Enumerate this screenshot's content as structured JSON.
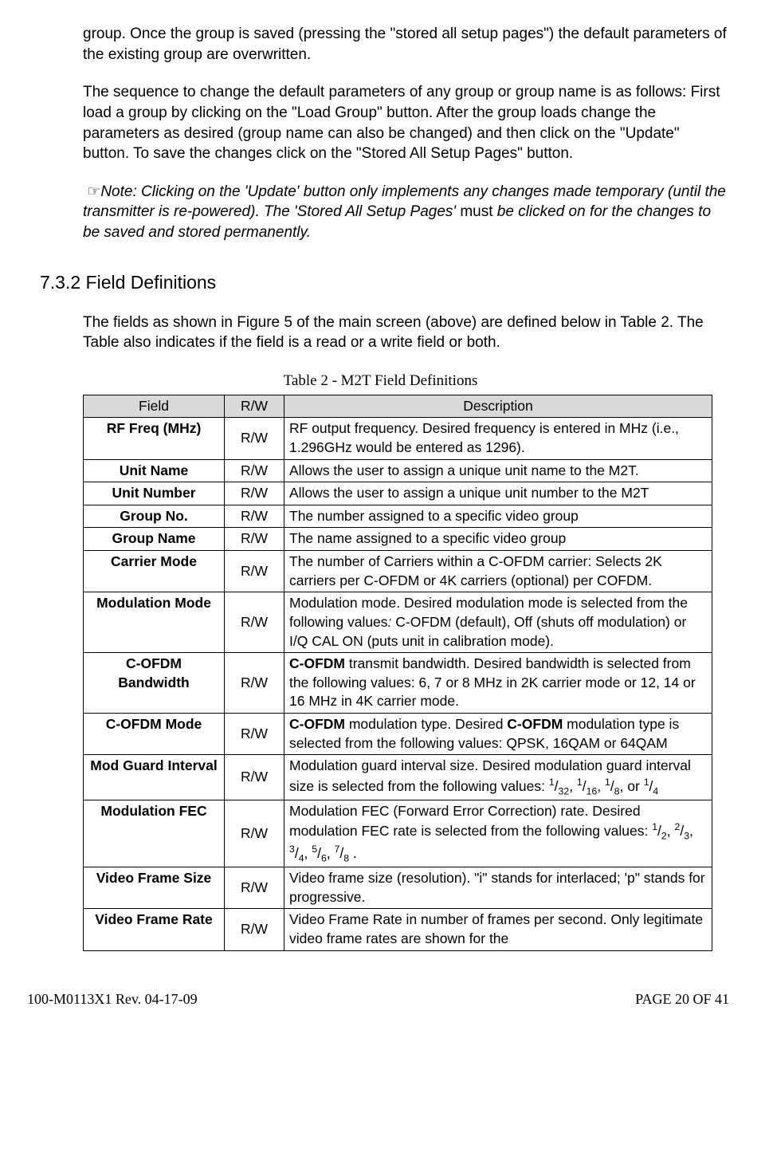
{
  "paragraphs": {
    "p1": "group. Once the group is saved (pressing the \"stored all setup pages\") the default parameters of the existing group are overwritten.",
    "p2": "The sequence to change the default parameters of any group or group name is as follows: First load a group by clicking on the \"Load Group\" button. After the group loads change the parameters as desired (group name can also be changed) and then click on the \"Update\" button.  To save the changes click on the \"Stored All Setup Pages\" button.",
    "note_prefix": "Note: Clicking on the 'Update' button only implements any changes made temporary (until the transmitter is re-powered).  The 'Stored All Setup Pages' ",
    "note_must": "must",
    "note_suffix": " be clicked on for the changes to be saved and stored permanently."
  },
  "section": {
    "number": "7.3.2",
    "title": "Field Definitions"
  },
  "intro": "The fields as shown in Figure 5 of the main screen (above) are defined below in Table 2. The Table also indicates if the field is a read or a write field or both.",
  "table_caption": "Table 2 - M2T Field Definitions",
  "headers": {
    "field": "Field",
    "rw": "R/W",
    "desc": "Description"
  },
  "rows": [
    {
      "field": "RF Freq (MHz)",
      "rw": "R/W",
      "desc": "RF output frequency.  Desired frequency is entered in MHz (i.e., 1.296GHz would be entered as 1296)."
    },
    {
      "field": "Unit Name",
      "rw": "R/W",
      "desc": "Allows the user to assign a unique unit name to the M2T."
    },
    {
      "field": "Unit Number",
      "rw": "R/W",
      "desc": "Allows the user to assign a unique unit number to the M2T"
    },
    {
      "field": "Group No.",
      "rw": "R/W",
      "desc": "The number assigned to a specific video group"
    },
    {
      "field": "Group Name",
      "rw": "R/W",
      "desc": "The name assigned to a specific video group"
    },
    {
      "field": "Carrier Mode",
      "rw": "R/W",
      "desc": "The number of Carriers within a C-OFDM carrier: Selects 2K carriers per C-OFDM or 4K carriers (optional) per COFDM."
    },
    {
      "field": "Modulation Mode",
      "rw": "R/W",
      "desc_pre": "Modulation mode.  Desired modulation mode is selected from the following values",
      "desc_italic": ": ",
      "desc_post": "C-OFDM (default), Off (shuts off modulation) or I/Q CAL ON (puts unit in calibration mode)."
    },
    {
      "field": "C-OFDM Bandwidth",
      "rw": "R/W",
      "desc_bold": "C-OFDM",
      "desc_post": " transmit bandwidth.  Desired bandwidth is selected from the following values:  6, 7 or 8 MHz in 2K carrier mode or 12, 14 or 16 MHz in 4K carrier mode."
    },
    {
      "field": "C-OFDM Mode",
      "rw": "R/W",
      "desc_bold": "C-OFDM",
      "desc_mid": " modulation type.  Desired ",
      "desc_bold2": "C-OFDM",
      "desc_post": " modulation type is selected from the following values: QPSK, 16QAM or 64QAM"
    },
    {
      "field": "Mod Guard Interval",
      "rw": "R/W",
      "desc_pre": "Modulation guard interval size.  Desired modulation guard interval size is selected from the following values: ",
      "fractions": [
        [
          "1",
          "32"
        ],
        [
          "1",
          "16"
        ],
        [
          "1",
          "8"
        ]
      ],
      "or_fraction": [
        "1",
        "4"
      ]
    },
    {
      "field": "Modulation FEC",
      "rw": "R/W",
      "desc_pre": "Modulation FEC (Forward Error Correction) rate.  Desired modulation FEC rate is selected from the following values: ",
      "fractions": [
        [
          "1",
          "2"
        ],
        [
          "2",
          "3"
        ],
        [
          "3",
          "4"
        ],
        [
          "5",
          "6"
        ],
        [
          "7",
          "8"
        ]
      ],
      "trailing": " ."
    },
    {
      "field": "Video Frame Size",
      "rw": "R/W",
      "desc": "Video frame size (resolution). \"i\" stands for interlaced; 'p\" stands for progressive."
    },
    {
      "field": "Video Frame Rate",
      "rw": "R/W",
      "desc": "Video Frame Rate in number of frames per second.  Only legitimate video frame rates are shown for the"
    }
  ],
  "footer": {
    "left": "100-M0113X1 Rev. 04-17-09",
    "right": "PAGE 20 OF 41"
  }
}
